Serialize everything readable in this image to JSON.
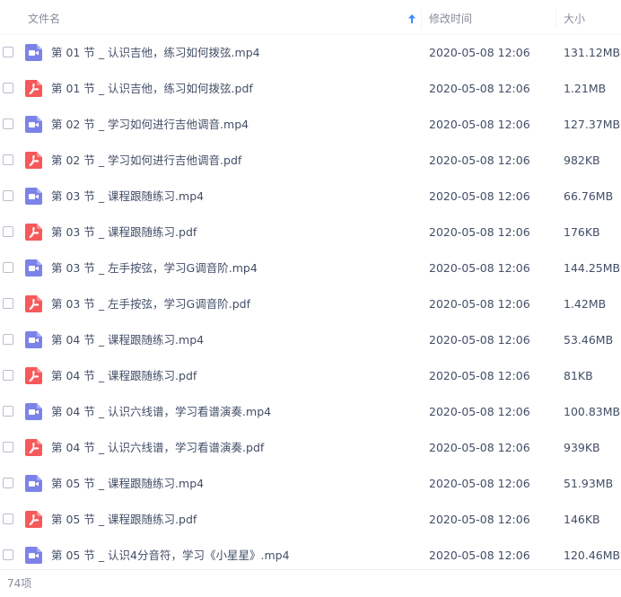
{
  "header": {
    "name_label": "文件名",
    "sort_icon": "arrow-up-icon",
    "time_label": "修改时间",
    "size_label": "大小"
  },
  "colors": {
    "video_icon": "#7b83e8",
    "pdf_icon": "#f5595b",
    "sort_arrow": "#3b8cff"
  },
  "files": [
    {
      "name": "第 01 节 _ 认识吉他，练习如何拨弦.mp4",
      "modified": "2020-05-08 12:06",
      "size": "131.12MB",
      "type": "video"
    },
    {
      "name": "第 01 节 _ 认识吉他，练习如何拨弦.pdf",
      "modified": "2020-05-08 12:06",
      "size": "1.21MB",
      "type": "pdf"
    },
    {
      "name": "第 02 节 _ 学习如何进行吉他调音.mp4",
      "modified": "2020-05-08 12:06",
      "size": "127.37MB",
      "type": "video"
    },
    {
      "name": "第 02 节 _ 学习如何进行吉他调音.pdf",
      "modified": "2020-05-08 12:06",
      "size": "982KB",
      "type": "pdf"
    },
    {
      "name": "第 03 节 _ 课程跟随练习.mp4",
      "modified": "2020-05-08 12:06",
      "size": "66.76MB",
      "type": "video"
    },
    {
      "name": "第 03 节 _ 课程跟随练习.pdf",
      "modified": "2020-05-08 12:06",
      "size": "176KB",
      "type": "pdf"
    },
    {
      "name": "第 03 节 _ 左手按弦，学习G调音阶.mp4",
      "modified": "2020-05-08 12:06",
      "size": "144.25MB",
      "type": "video"
    },
    {
      "name": "第 03 节 _ 左手按弦，学习G调音阶.pdf",
      "modified": "2020-05-08 12:06",
      "size": "1.42MB",
      "type": "pdf"
    },
    {
      "name": "第 04 节 _ 课程跟随练习.mp4",
      "modified": "2020-05-08 12:06",
      "size": "53.46MB",
      "type": "video"
    },
    {
      "name": "第 04 节 _ 课程跟随练习.pdf",
      "modified": "2020-05-08 12:06",
      "size": "81KB",
      "type": "pdf"
    },
    {
      "name": "第 04 节 _ 认识六线谱，学习看谱演奏.mp4",
      "modified": "2020-05-08 12:06",
      "size": "100.83MB",
      "type": "video"
    },
    {
      "name": "第 04 节 _ 认识六线谱，学习看谱演奏.pdf",
      "modified": "2020-05-08 12:06",
      "size": "939KB",
      "type": "pdf"
    },
    {
      "name": "第 05 节 _ 课程跟随练习.mp4",
      "modified": "2020-05-08 12:06",
      "size": "51.93MB",
      "type": "video"
    },
    {
      "name": "第 05 节 _ 课程跟随练习.pdf",
      "modified": "2020-05-08 12:06",
      "size": "146KB",
      "type": "pdf"
    },
    {
      "name": "第 05 节 _ 认识4分音符，学习《小星星》.mp4",
      "modified": "2020-05-08 12:06",
      "size": "120.46MB",
      "type": "video"
    }
  ],
  "footer": {
    "item_count": "74项"
  }
}
